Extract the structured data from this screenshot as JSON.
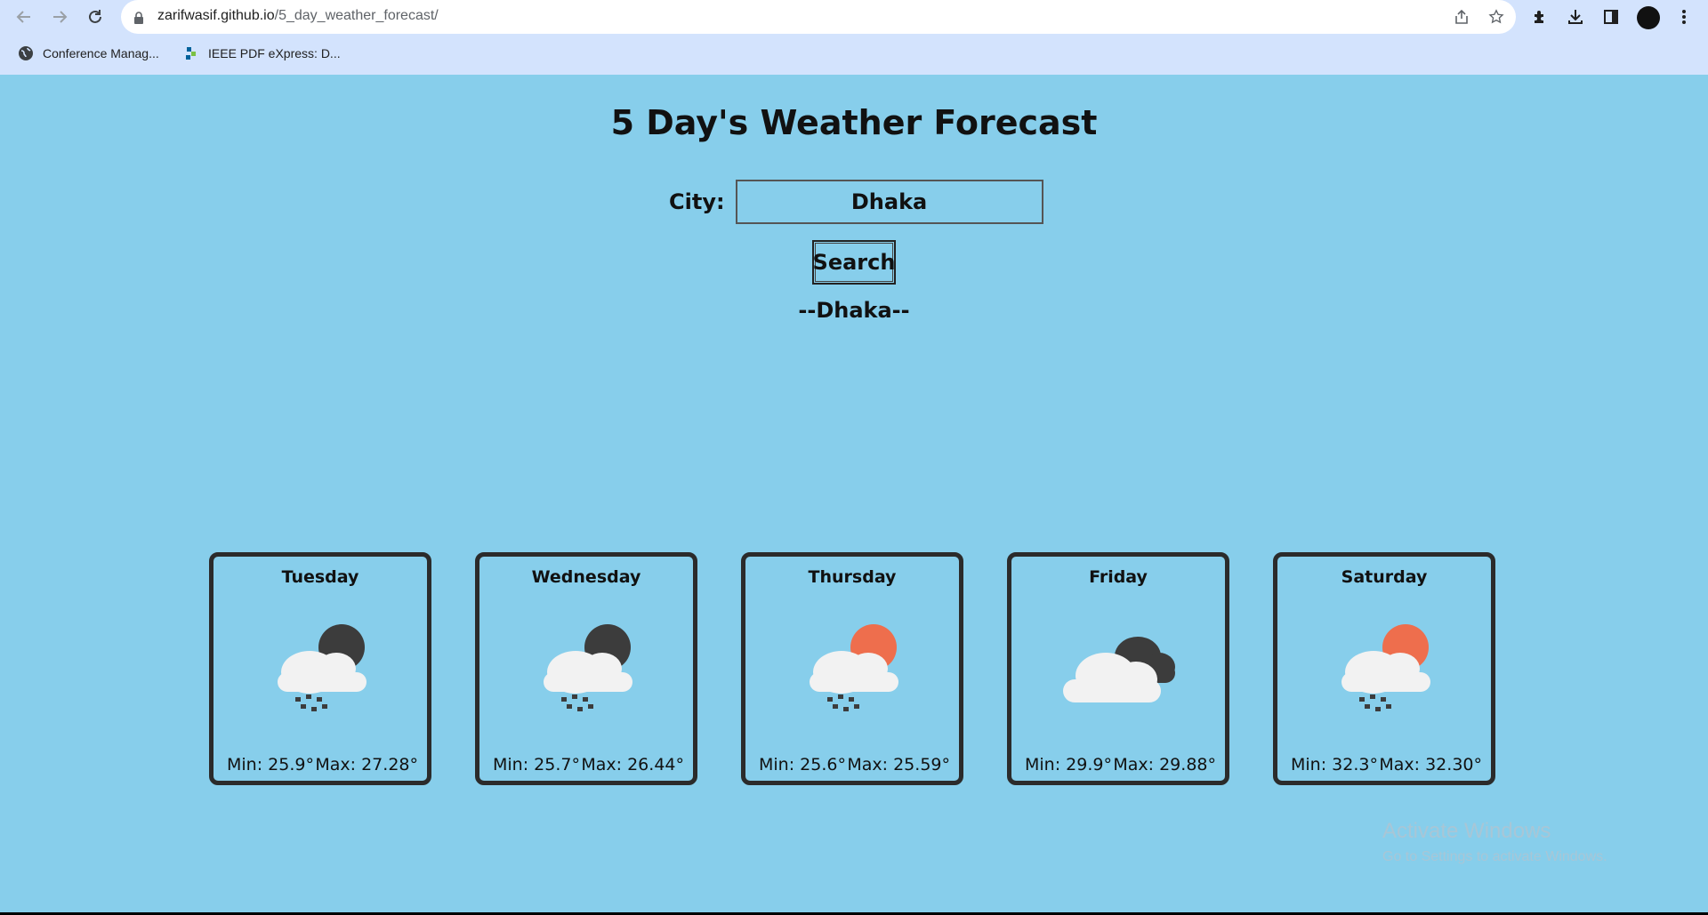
{
  "browser": {
    "url_host": "zarifwasif.github.io",
    "url_path": "/5_day_weather_forecast/",
    "bookmarks": [
      {
        "label": "Conference Manag...",
        "icon": "globe-icon"
      },
      {
        "label": "IEEE PDF eXpress: D...",
        "icon": "ieee-icon"
      }
    ]
  },
  "page": {
    "title": "5 Day's Weather Forecast",
    "city_label": "City:",
    "city_value": "Dhaka",
    "search_label": "Search",
    "city_heading": "--Dhaka--"
  },
  "forecast": [
    {
      "day": "Tuesday",
      "min": "Min: 25.9°",
      "max": "Max: 27.28°",
      "icon": "cloud-rain-night-icon"
    },
    {
      "day": "Wednesday",
      "min": "Min: 25.7°",
      "max": "Max: 26.44°",
      "icon": "cloud-rain-night-icon"
    },
    {
      "day": "Thursday",
      "min": "Min: 25.6°",
      "max": "Max: 25.59°",
      "icon": "cloud-rain-sun-icon"
    },
    {
      "day": "Friday",
      "min": "Min: 29.9°",
      "max": "Max: 29.88°",
      "icon": "broken-clouds-icon"
    },
    {
      "day": "Saturday",
      "min": "Min: 32.3°",
      "max": "Max: 32.30°",
      "icon": "cloud-rain-sun-icon"
    }
  ],
  "watermark": {
    "title": "Activate Windows",
    "subtitle": "Go to Settings to activate Windows."
  },
  "colors": {
    "page_background": "#87ceeb",
    "card_border": "#2b2b2b",
    "sun": "#ee6e4d",
    "moon_cloud": "#3c3c3c",
    "cloud": "#f2f2f2"
  }
}
